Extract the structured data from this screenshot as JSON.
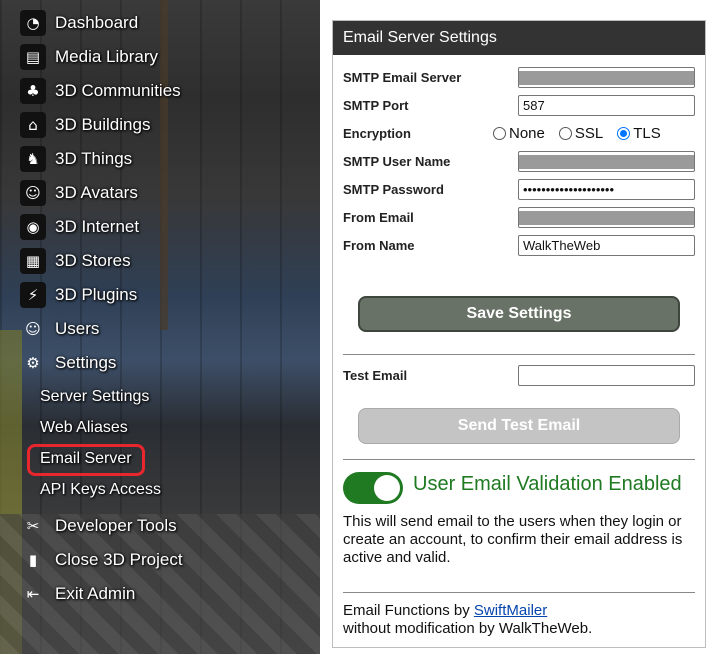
{
  "sidebar": {
    "items": [
      {
        "label": "Dashboard",
        "icon": "dashboard-gauge-icon",
        "glyph": "◔"
      },
      {
        "label": "Media Library",
        "icon": "film-icon",
        "glyph": "▤"
      },
      {
        "label": "3D Communities",
        "icon": "palm-island-icon",
        "glyph": "♣"
      },
      {
        "label": "3D Buildings",
        "icon": "building-icon",
        "glyph": "⌂"
      },
      {
        "label": "3D Things",
        "icon": "chair-icon",
        "glyph": "♞"
      },
      {
        "label": "3D Avatars",
        "icon": "avatars-icon",
        "glyph": "☺"
      },
      {
        "label": "3D Internet",
        "icon": "globe-icon",
        "glyph": "◉"
      },
      {
        "label": "3D Stores",
        "icon": "store-icon",
        "glyph": "▦"
      },
      {
        "label": "3D Plugins",
        "icon": "plug-icon",
        "glyph": "⚡"
      },
      {
        "label": "Users",
        "icon": "user-icon",
        "glyph": "☺"
      },
      {
        "label": "Settings",
        "icon": "gear-icon",
        "glyph": "⚙"
      }
    ],
    "sub_items": [
      {
        "label": "Server Settings"
      },
      {
        "label": "Web Aliases"
      },
      {
        "label": "Email Server",
        "selected": true
      },
      {
        "label": "API Keys Access"
      }
    ],
    "bottom_items": [
      {
        "label": "Developer Tools",
        "icon": "tools-icon",
        "glyph": "✂"
      },
      {
        "label": "Close 3D Project",
        "icon": "door-exit-icon",
        "glyph": "▮"
      },
      {
        "label": "Exit Admin",
        "icon": "logout-icon",
        "glyph": "⇤"
      }
    ],
    "highlight_color": "#e8262d"
  },
  "panel": {
    "title": "Email Server Settings",
    "fields": {
      "smtp_server_label": "SMTP Email Server",
      "smtp_server_value": "",
      "smtp_port_label": "SMTP Port",
      "smtp_port_value": "587",
      "encryption_label": "Encryption",
      "encryption_options": [
        "None",
        "SSL",
        "TLS"
      ],
      "encryption_selected": "TLS",
      "smtp_user_label": "SMTP User Name",
      "smtp_user_value": "",
      "smtp_password_label": "SMTP Password",
      "smtp_password_value": "••••••••••••••••••••",
      "from_email_label": "From Email",
      "from_email_value": "",
      "from_name_label": "From Name",
      "from_name_value": "WalkTheWeb"
    },
    "save_button": "Save Settings",
    "test_email_label": "Test Email",
    "test_email_value": "",
    "send_test_button": "Send Test Email",
    "validation_toggle_on": true,
    "validation_label": "User Email Validation Enabled",
    "validation_description": "This will send email to the users when they login or create an account, to confirm their email address is active and valid.",
    "footer_prefix": "Email Functions by ",
    "footer_link": "SwiftMailer",
    "footer_suffix": "without modification by WalkTheWeb.",
    "colors": {
      "header_bg": "#333333",
      "save_bg": "#687266",
      "test_bg": "#c4c4c4",
      "toggle_on": "#1f7a22",
      "radio_selected": "#0075ff"
    }
  }
}
